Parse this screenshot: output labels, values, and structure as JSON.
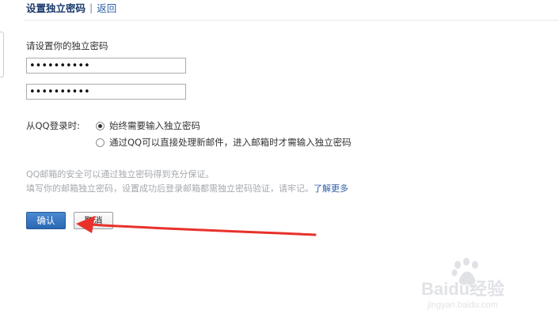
{
  "header": {
    "title": "设置独立密码",
    "separator": "|",
    "back_label": "返回"
  },
  "form": {
    "set_password_label": "请设置你的独立密码",
    "password_value": "••••••••••",
    "confirm_password_value": "••••••••••",
    "qq_login_label": "从QQ登录时:",
    "options": [
      {
        "label": "始终需要输入独立密码",
        "selected": true
      },
      {
        "label": "通过QQ可以直接处理新邮件，进入邮箱时才需输入独立密码",
        "selected": false
      }
    ]
  },
  "notes": {
    "line1": "QQ邮箱的安全可以通过独立密码得到充分保证。",
    "line2": "填写你的邮箱独立密码，设置成功后登录邮箱都需独立密码验证，请牢记。",
    "learn_more": "了解更多"
  },
  "buttons": {
    "confirm_label": "确认",
    "cancel_label": "取消"
  },
  "annotation": {
    "arrow_color": "#e8312a"
  },
  "watermark": {
    "brand": "Baidu经验",
    "url": "jingyan.baidu.com"
  }
}
